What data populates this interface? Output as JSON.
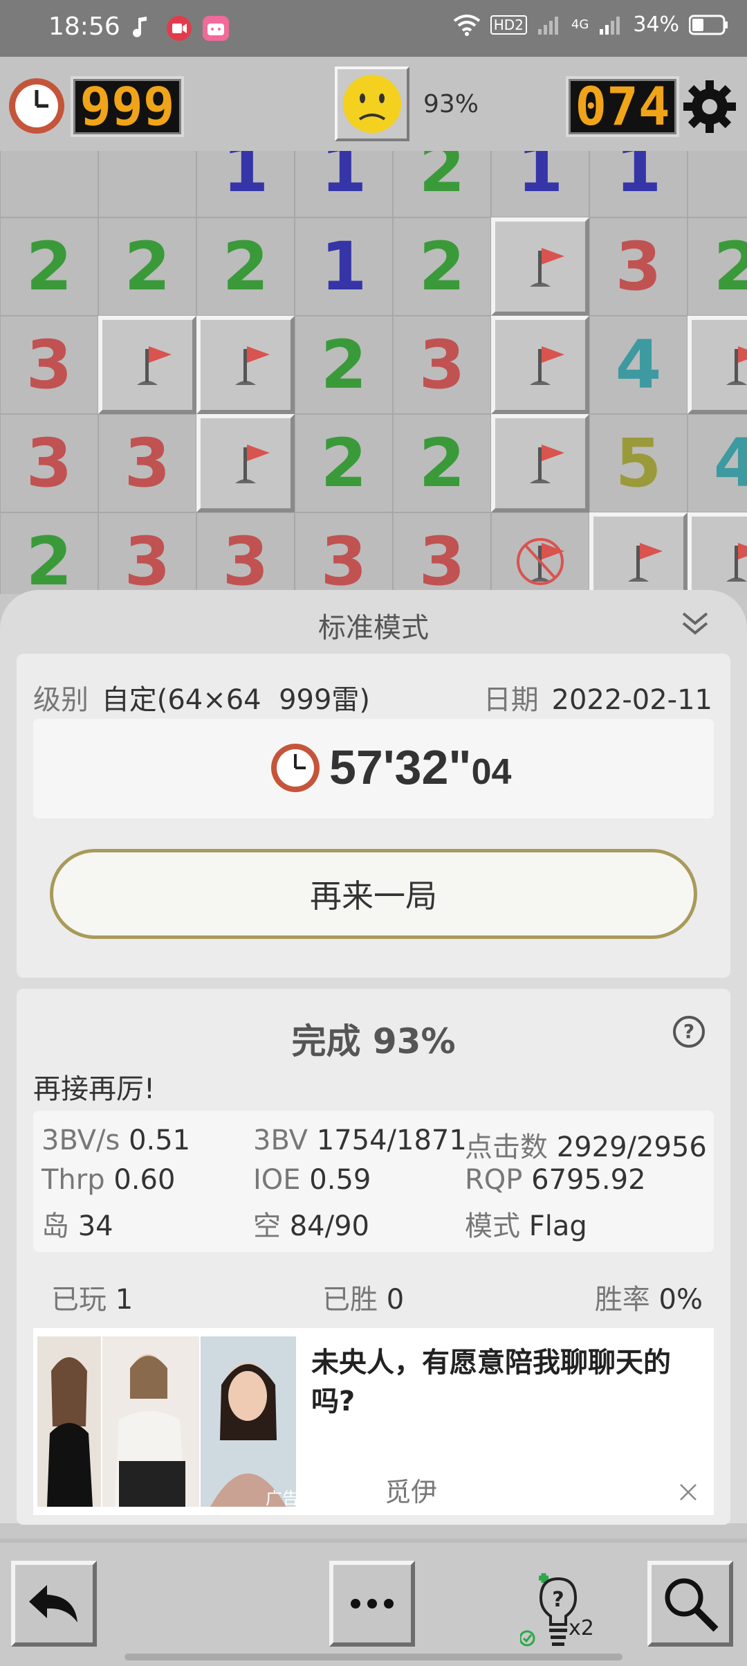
{
  "status_bar": {
    "time": "18:56",
    "network": "HD2",
    "network_gen": "4G",
    "battery": "34%",
    "icons": [
      "music-note-icon",
      "screen-record-icon",
      "bilibili-app-icon",
      "wifi-icon",
      "hd-voice-icon",
      "signal-bars-icon",
      "battery-icon"
    ]
  },
  "hud": {
    "timer": "999",
    "mines_left": "074",
    "progress": "93%",
    "face": "neutral-face-icon"
  },
  "board": {
    "colors": {
      "1": "#3535a8",
      "2": "#3a9a3a",
      "3": "#c15252",
      "4": "#3d9aa0",
      "5": "#9a9a3a"
    },
    "rows": [
      [
        "",
        "",
        "1",
        "1",
        "2",
        "1",
        "1",
        ""
      ],
      [
        "2",
        "2",
        "2",
        "1",
        "2",
        "F",
        "3",
        "2"
      ],
      [
        "3",
        "F",
        "F",
        "2",
        "3",
        "F",
        "4",
        "F"
      ],
      [
        "3",
        "3",
        "F",
        "2",
        "2",
        "F",
        "5",
        "4"
      ],
      [
        "2",
        "3",
        "3",
        "3",
        "3",
        "X",
        "F",
        "F"
      ]
    ]
  },
  "sheet": {
    "title": "标准模式",
    "level_label": "级别",
    "level_value": "自定(64×64  999雷)",
    "date_label": "日期",
    "date_value": "2022-02-11",
    "time_main": "57'32\"",
    "time_frac": "04",
    "again_button": "再来一局",
    "completion": "完成 93%",
    "encourage": "再接再厉!",
    "stats": {
      "bv_s_label": "3BV/s",
      "bv_s": "0.51",
      "bv_label": "3BV",
      "bv": "1754/1871",
      "clicks_label": "点击数",
      "clicks": "2929/2956",
      "thrp_label": "Thrp",
      "thrp": "0.60",
      "ioe_label": "IOE",
      "ioe": "0.59",
      "rqp_label": "RQP",
      "rqp": "6795.92",
      "island_label": "岛",
      "island": "34",
      "empty_label": "空",
      "empty": "84/90",
      "mode_label": "模式",
      "mode": "Flag"
    },
    "record": {
      "played_label": "已玩",
      "played": "1",
      "won_label": "已胜",
      "won": "0",
      "rate_label": "胜率",
      "rate": "0%"
    },
    "ad": {
      "headline": "未央人，有愿意陪我聊聊天的吗?",
      "brand": "觅伊",
      "ad_tag": "广告"
    }
  },
  "bottom_bar": {
    "hint_count": "x2",
    "buttons": [
      "undo-icon",
      "more-icon",
      "hint-icon",
      "magnifier-icon"
    ]
  }
}
